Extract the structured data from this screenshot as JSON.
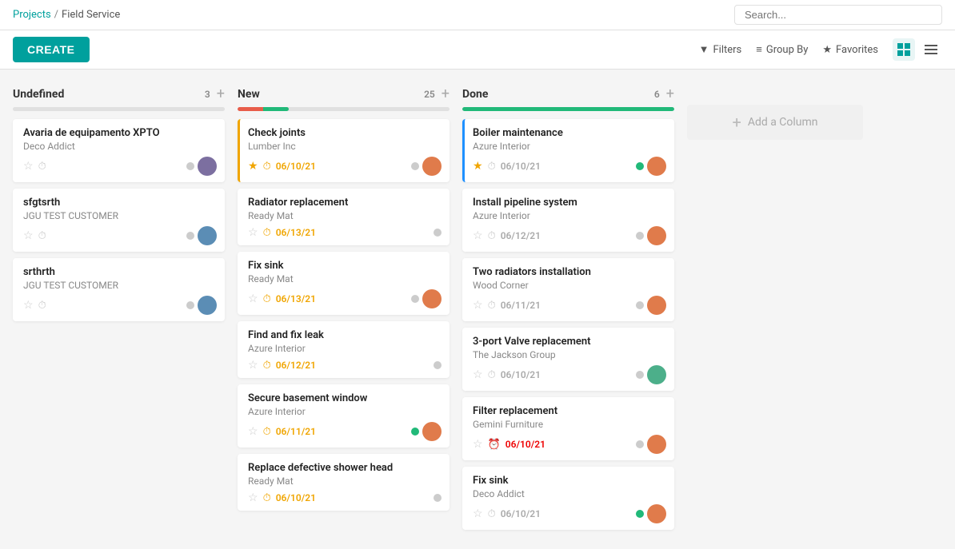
{
  "breadcrumb": {
    "link": "Projects",
    "separator": "/",
    "current": "Field Service"
  },
  "search": {
    "placeholder": "Search..."
  },
  "toolbar": {
    "create_label": "CREATE",
    "filters_label": "Filters",
    "groupby_label": "Group By",
    "favorites_label": "Favorites"
  },
  "columns": [
    {
      "id": "undefined",
      "title": "Undefined",
      "count": 3,
      "progress": 0,
      "progress_color": "#e0e0e0",
      "cards": [
        {
          "title": "Avaria de equipamento XPTO",
          "subtitle": "Deco Addict",
          "star": false,
          "date": "",
          "avatar": "av1",
          "status": "none",
          "border": ""
        },
        {
          "title": "sfgtsrth",
          "subtitle": "JGU TEST CUSTOMER",
          "star": false,
          "date": "",
          "avatar": "av2",
          "status": "none",
          "border": ""
        },
        {
          "title": "srthrth",
          "subtitle": "JGU TEST CUSTOMER",
          "star": false,
          "date": "",
          "avatar": "av2",
          "status": "none",
          "border": ""
        }
      ]
    },
    {
      "id": "new",
      "title": "New",
      "count": 25,
      "progress": 12,
      "progress_color": "#e85d4a",
      "progress_color2": "#21b979",
      "cards": [
        {
          "title": "Check joints",
          "subtitle": "Lumber Inc",
          "star": true,
          "date": "06/10/21",
          "date_style": "orange",
          "avatar": "av3",
          "status": "none",
          "border": "orange"
        },
        {
          "title": "Radiator replacement",
          "subtitle": "Ready Mat",
          "star": false,
          "date": "06/13/21",
          "date_style": "orange",
          "avatar": "",
          "status": "none",
          "border": ""
        },
        {
          "title": "Fix sink",
          "subtitle": "Ready Mat",
          "star": false,
          "date": "06/13/21",
          "date_style": "orange",
          "avatar": "av3",
          "status": "none",
          "border": ""
        },
        {
          "title": "Find and fix leak",
          "subtitle": "Azure Interior",
          "star": false,
          "date": "06/12/21",
          "date_style": "orange",
          "avatar": "",
          "status": "none",
          "border": ""
        },
        {
          "title": "Secure basement window",
          "subtitle": "Azure Interior",
          "star": false,
          "date": "06/11/21",
          "date_style": "orange",
          "avatar": "av3",
          "status": "green",
          "border": ""
        },
        {
          "title": "Replace defective shower head",
          "subtitle": "Ready Mat",
          "star": false,
          "date": "06/10/21",
          "date_style": "orange",
          "avatar": "",
          "status": "none",
          "border": ""
        }
      ]
    },
    {
      "id": "done",
      "title": "Done",
      "count": 6,
      "progress": 100,
      "progress_color": "#21b979",
      "cards": [
        {
          "title": "Boiler maintenance",
          "subtitle": "Azure Interior",
          "star": true,
          "date": "06/10/21",
          "date_style": "normal",
          "avatar": "av3",
          "status": "green",
          "border": "blue"
        },
        {
          "title": "Install pipeline system",
          "subtitle": "Azure Interior",
          "star": false,
          "date": "06/12/21",
          "date_style": "normal",
          "avatar": "av3",
          "status": "none",
          "border": ""
        },
        {
          "title": "Two radiators installation",
          "subtitle": "Wood Corner",
          "star": false,
          "date": "06/11/21",
          "date_style": "normal",
          "avatar": "av3",
          "status": "none",
          "border": ""
        },
        {
          "title": "3-port Valve replacement",
          "subtitle": "The Jackson Group",
          "star": false,
          "date": "06/10/21",
          "date_style": "normal",
          "avatar": "av4",
          "status": "none",
          "border": ""
        },
        {
          "title": "Filter replacement",
          "subtitle": "Gemini Furniture",
          "star": false,
          "date": "06/10/21",
          "date_style": "red",
          "avatar": "av3",
          "status": "none",
          "border": ""
        },
        {
          "title": "Fix sink",
          "subtitle": "Deco Addict",
          "star": false,
          "date": "06/10/21",
          "date_style": "normal",
          "avatar": "av3",
          "status": "green",
          "border": ""
        }
      ]
    }
  ],
  "add_column_label": "Add a Column"
}
